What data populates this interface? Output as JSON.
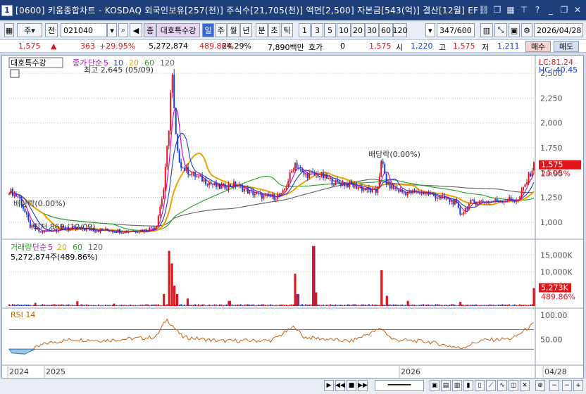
{
  "window": {
    "screen_no": "1",
    "title": "[0600] 키움종합차트 - KOSDAQ 외국인보유[257(천)] 주식수[21,705(천)] 액면[2,500] 자본금[543(억)] 결산[12월] EF"
  },
  "toolbar": {
    "type_select": "주",
    "prev_label": "전",
    "code": "021040",
    "stock_tag": "종",
    "stock_name": "대호특수강",
    "periods": [
      "일",
      "주",
      "월",
      "년",
      "분",
      "초",
      "틱"
    ],
    "selected_period": "일",
    "intervals": [
      "1",
      "3",
      "5",
      "10",
      "20",
      "30",
      "60",
      "120"
    ],
    "count": "347",
    "count_max": "/600",
    "date": "2026/04/28"
  },
  "quote": {
    "price": "1,575",
    "change": "363",
    "change_pct": "+29.95%",
    "volume": "5,272,874",
    "volume_ratio": "489.86%",
    "turnover": "24.29%",
    "amount": "7,890백만",
    "hoga_label": "호가",
    "hoga_value": "0",
    "hoga_price": "1,575",
    "open_label": "시",
    "open": "1,220",
    "high_label": "고",
    "high": "1,575",
    "low_label": "저",
    "low": "1,211",
    "buy_label": "매수",
    "sell_label": "매도"
  },
  "chart_data": [
    {
      "type": "candlestick",
      "title": "대호특수강",
      "legend": [
        "종가",
        "단순",
        "5",
        "10",
        "20",
        "60",
        "120"
      ],
      "ma_colors": {
        "5": "#cc00cc",
        "10": "#1f3fd0",
        "20": "#f0a000",
        "60": "#20a020",
        "120": "#606060"
      },
      "ylim": [
        850,
        2650
      ],
      "yticks": [
        1000,
        1250,
        1500,
        1750,
        2000,
        2250,
        2500
      ],
      "ytick_labels": [
        "1,000",
        "1,250",
        "1,500",
        "1,750",
        "2,000",
        "2,250",
        "2,500"
      ],
      "lc": "LC:81.24",
      "hc": "HC:-40.45",
      "annotations": {
        "high": "최고 2,645 (05/09)",
        "low": "최저 869 (12/09)",
        "dividend_1": "배당락(0.00%)",
        "dividend_2": "배당락(0.00%)"
      },
      "current_price_label": "1,575",
      "current_change_label": "29.95%",
      "close_path": [
        {
          "t": 0.0,
          "v": 1320
        },
        {
          "t": 0.02,
          "v": 1240
        },
        {
          "t": 0.04,
          "v": 960
        },
        {
          "t": 0.06,
          "v": 900
        },
        {
          "t": 0.1,
          "v": 940
        },
        {
          "t": 0.14,
          "v": 930
        },
        {
          "t": 0.18,
          "v": 920
        },
        {
          "t": 0.22,
          "v": 910
        },
        {
          "t": 0.26,
          "v": 920
        },
        {
          "t": 0.28,
          "v": 960
        },
        {
          "t": 0.295,
          "v": 1350
        },
        {
          "t": 0.305,
          "v": 2000
        },
        {
          "t": 0.31,
          "v": 2560
        },
        {
          "t": 0.315,
          "v": 2060
        },
        {
          "t": 0.32,
          "v": 1700
        },
        {
          "t": 0.33,
          "v": 1550
        },
        {
          "t": 0.36,
          "v": 1450
        },
        {
          "t": 0.4,
          "v": 1350
        },
        {
          "t": 0.43,
          "v": 1380
        },
        {
          "t": 0.46,
          "v": 1300
        },
        {
          "t": 0.49,
          "v": 1250
        },
        {
          "t": 0.52,
          "v": 1270
        },
        {
          "t": 0.545,
          "v": 1600
        },
        {
          "t": 0.56,
          "v": 1480
        },
        {
          "t": 0.59,
          "v": 1480
        },
        {
          "t": 0.62,
          "v": 1400
        },
        {
          "t": 0.65,
          "v": 1380
        },
        {
          "t": 0.68,
          "v": 1330
        },
        {
          "t": 0.7,
          "v": 1300
        },
        {
          "t": 0.71,
          "v": 1620
        },
        {
          "t": 0.72,
          "v": 1380
        },
        {
          "t": 0.75,
          "v": 1300
        },
        {
          "t": 0.79,
          "v": 1300
        },
        {
          "t": 0.82,
          "v": 1250
        },
        {
          "t": 0.85,
          "v": 1200
        },
        {
          "t": 0.86,
          "v": 1080
        },
        {
          "t": 0.88,
          "v": 1200
        },
        {
          "t": 0.92,
          "v": 1210
        },
        {
          "t": 0.95,
          "v": 1230
        },
        {
          "t": 0.97,
          "v": 1220
        },
        {
          "t": 1.0,
          "v": 1575
        }
      ]
    },
    {
      "type": "bar",
      "title": "거래량",
      "legend": [
        "거래량",
        "단순",
        "5",
        "20",
        "60",
        "120"
      ],
      "current_label": "5,272,874주(489.86%)",
      "yticks": [
        10000,
        15000
      ],
      "ytick_labels": [
        "10,000K",
        "15,000K"
      ],
      "ylim": [
        0,
        19000
      ],
      "current_value_label": "5,273K",
      "current_pct_label": "489.86%",
      "spikes": [
        {
          "t": 0.05,
          "v": 900
        },
        {
          "t": 0.13,
          "v": 1400
        },
        {
          "t": 0.2,
          "v": 700
        },
        {
          "t": 0.295,
          "v": 3500
        },
        {
          "t": 0.305,
          "v": 16200
        },
        {
          "t": 0.31,
          "v": 12500
        },
        {
          "t": 0.315,
          "v": 6000
        },
        {
          "t": 0.32,
          "v": 3500
        },
        {
          "t": 0.34,
          "v": 2200
        },
        {
          "t": 0.42,
          "v": 1500
        },
        {
          "t": 0.545,
          "v": 9500
        },
        {
          "t": 0.55,
          "v": 3500
        },
        {
          "t": 0.58,
          "v": 17600
        },
        {
          "t": 0.585,
          "v": 4000
        },
        {
          "t": 0.71,
          "v": 10500
        },
        {
          "t": 0.72,
          "v": 3000
        },
        {
          "t": 0.76,
          "v": 1500
        },
        {
          "t": 0.86,
          "v": 1200
        },
        {
          "t": 1.0,
          "v": 5273
        }
      ]
    },
    {
      "type": "line",
      "title": "RSI 14",
      "ylim": [
        0,
        110
      ],
      "yticks": [
        50,
        100
      ],
      "ytick_labels": [
        "50.00",
        "100.00"
      ],
      "guides": [
        30,
        70
      ],
      "path": [
        {
          "t": 0.0,
          "v": 30
        },
        {
          "t": 0.03,
          "v": 22
        },
        {
          "t": 0.07,
          "v": 42
        },
        {
          "t": 0.12,
          "v": 50
        },
        {
          "t": 0.18,
          "v": 48
        },
        {
          "t": 0.24,
          "v": 52
        },
        {
          "t": 0.28,
          "v": 55
        },
        {
          "t": 0.3,
          "v": 92
        },
        {
          "t": 0.31,
          "v": 80
        },
        {
          "t": 0.33,
          "v": 55
        },
        {
          "t": 0.4,
          "v": 47
        },
        {
          "t": 0.5,
          "v": 48
        },
        {
          "t": 0.545,
          "v": 77
        },
        {
          "t": 0.56,
          "v": 55
        },
        {
          "t": 0.65,
          "v": 46
        },
        {
          "t": 0.71,
          "v": 73
        },
        {
          "t": 0.73,
          "v": 50
        },
        {
          "t": 0.8,
          "v": 45
        },
        {
          "t": 0.86,
          "v": 32
        },
        {
          "t": 0.9,
          "v": 48
        },
        {
          "t": 0.96,
          "v": 52
        },
        {
          "t": 1.0,
          "v": 82
        }
      ]
    }
  ],
  "xaxis": {
    "labels": [
      "2024",
      "2025",
      "2026",
      "04/28"
    ]
  }
}
